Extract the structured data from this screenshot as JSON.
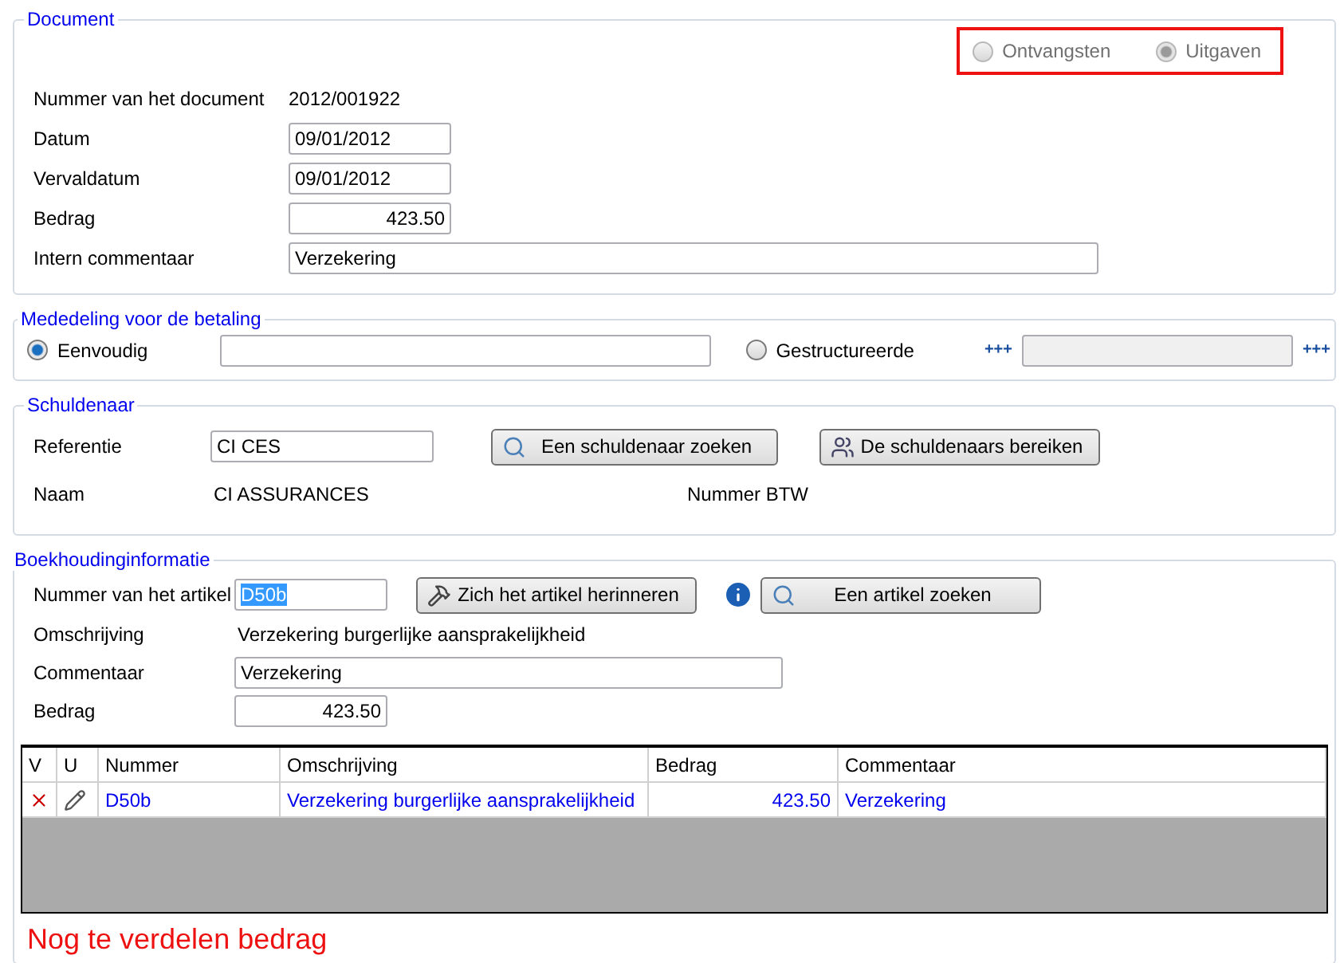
{
  "document": {
    "title": "Document",
    "type_options": [
      {
        "label": "Ontvangsten",
        "selected": false,
        "disabled": true
      },
      {
        "label": "Uitgaven",
        "selected": true,
        "disabled": true
      }
    ],
    "fields": [
      {
        "label": "Nummer van het document",
        "value": "2012/001922",
        "kind": "text"
      },
      {
        "label": "Datum",
        "value": "09/01/2012",
        "kind": "short"
      },
      {
        "label": "Vervaldatum",
        "value": "09/01/2012",
        "kind": "short"
      },
      {
        "label": "Bedrag",
        "value": "423.50",
        "kind": "amount"
      },
      {
        "label": "Intern commentaar",
        "value": "Verzekering",
        "kind": "long"
      }
    ]
  },
  "payment_message": {
    "title": "Mededeling voor de betaling",
    "options": [
      {
        "label": "Eenvoudig",
        "selected": true
      },
      {
        "label": "Gestructureerde",
        "selected": false
      }
    ],
    "structured": {
      "prefix": "+++",
      "suffix": "+++",
      "disabled": true
    }
  },
  "debtor": {
    "title": "Schuldenaar",
    "reference": {
      "label": "Referentie",
      "value": "CI CES"
    },
    "buttons": [
      {
        "label": "Een schuldenaar zoeken",
        "kind": "search"
      },
      {
        "label": "De schuldenaars bereiken",
        "kind": "people"
      }
    ],
    "name": {
      "label": "Naam",
      "value": "CI ASSURANCES"
    },
    "vat": {
      "label": "Nummer BTW"
    }
  },
  "accounting": {
    "title": "Boekhoudinginformatie",
    "article": {
      "label": "Nummer van het artikel",
      "value": "D50b",
      "highlighted": true
    },
    "buttons": [
      {
        "label": "Zich het artikel herinneren",
        "kind": "tools"
      },
      {
        "label": "Een artikel zoeken",
        "kind": "search"
      }
    ],
    "description": {
      "label": "Omschrijving",
      "value": "Verzekering burgerlijke aansprakelijkheid"
    },
    "comment": {
      "label": "Commentaar",
      "value": "Verzekering"
    },
    "amount": {
      "label": "Bedrag",
      "value": "423.50"
    },
    "table": {
      "columns": [
        "V",
        "U",
        "Nummer",
        "Omschrijving",
        "Bedrag",
        "Commentaar"
      ],
      "rows": [
        {
          "number": "D50b",
          "description": "Verzekering burgerlijke aansprakelijkheid",
          "amount": "423.50",
          "comment": "Verzekering"
        }
      ]
    },
    "remaining_label": "Nog te verdelen bedrag"
  }
}
